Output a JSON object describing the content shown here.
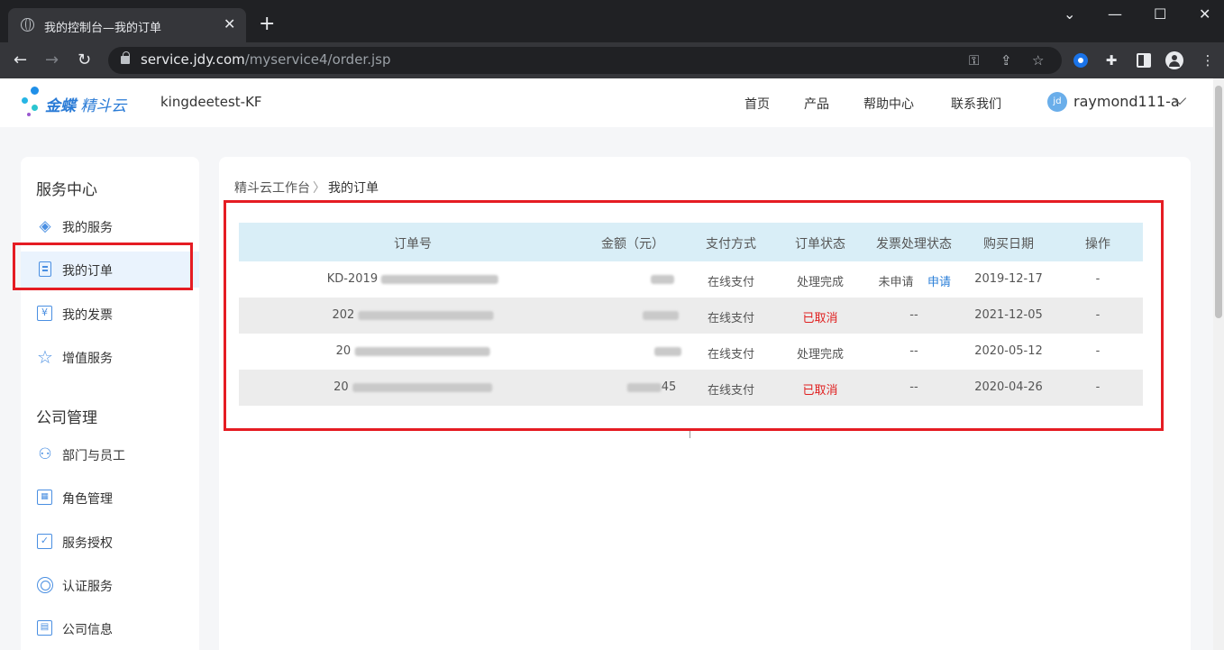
{
  "browser": {
    "tab_title": "我的控制台—我的订单",
    "tab_close": "✕",
    "new_tab": "+",
    "url_host": "service.jdy.com",
    "url_path": "/myservice4/order.jsp",
    "back": "←",
    "forward": "→",
    "reload": "↻",
    "window_controls": {
      "dropdown": "⌄",
      "minimize": "—",
      "maximize": "☐",
      "close": "✕"
    }
  },
  "header": {
    "logo_brand": "金蝶",
    "logo_product": "精斗云",
    "tenant": "kingdeetest-KF",
    "nav": [
      "首页",
      "产品",
      "帮助中心",
      "联系我们"
    ],
    "avatar_initials": "jd",
    "username": "raymond111-a"
  },
  "colors": {
    "accent": "#2a7bd6",
    "highlight_box": "#e51c23",
    "cancelled": "#e02020",
    "table_header": "#d9eef7"
  },
  "sidebar": {
    "section_service": "服务中心",
    "service_items": [
      {
        "label": "我的服务",
        "icon": "layers-icon"
      },
      {
        "label": "我的订单",
        "icon": "document-icon",
        "active": true
      },
      {
        "label": "我的发票",
        "icon": "invoice-yen-icon"
      },
      {
        "label": "增值服务",
        "icon": "star-icon"
      }
    ],
    "section_company": "公司管理",
    "company_items": [
      {
        "label": "部门与员工",
        "icon": "users-icon"
      },
      {
        "label": "角色管理",
        "icon": "role-card-icon"
      },
      {
        "label": "服务授权",
        "icon": "checkbox-icon"
      },
      {
        "label": "认证服务",
        "icon": "target-icon"
      },
      {
        "label": "公司信息",
        "icon": "building-icon"
      }
    ]
  },
  "main": {
    "breadcrumb": {
      "parent": "精斗云工作台",
      "separator": "〉",
      "current": "我的订单"
    },
    "table": {
      "columns": [
        "订单号",
        "金额（元）",
        "支付方式",
        "订单状态",
        "发票处理状态",
        "购买日期",
        "操作"
      ],
      "rows": [
        {
          "order_no": "KD-2019",
          "amount": "",
          "payment": "在线支付",
          "status": "处理完成",
          "invoice_status": "未申请",
          "invoice_action": "申请",
          "date": "2019-12-17",
          "op": "-"
        },
        {
          "order_no": "202",
          "amount": "",
          "payment": "在线支付",
          "status": "已取消",
          "invoice_status": "--",
          "invoice_action": "",
          "date": "2021-12-05",
          "op": "-"
        },
        {
          "order_no": "20",
          "amount": "",
          "payment": "在线支付",
          "status": "处理完成",
          "invoice_status": "--",
          "invoice_action": "",
          "date": "2020-05-12",
          "op": "-"
        },
        {
          "order_no": "20",
          "amount": "45",
          "payment": "在线支付",
          "status": "已取消",
          "invoice_status": "--",
          "invoice_action": "",
          "date": "2020-04-26",
          "op": "-"
        }
      ]
    }
  }
}
